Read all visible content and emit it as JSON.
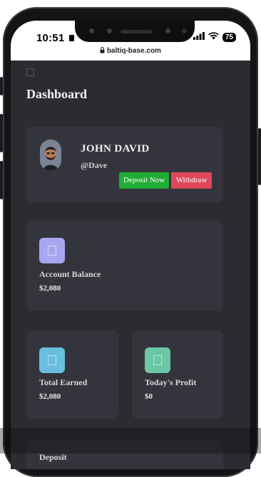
{
  "status_bar": {
    "time": "10:51",
    "signal_icon": "signal-bars-icon",
    "wifi_icon": "wifi-icon",
    "battery_level": "75"
  },
  "browser": {
    "url": "baltiq-base.com",
    "lock_icon": "lock-icon"
  },
  "header": {
    "title": "Dashboard",
    "menu_icon": "menu-icon"
  },
  "profile": {
    "name": "JOHN DAVID",
    "handle": "@Dave",
    "deposit_label": "Deposit Now",
    "withdraw_label": "Withdraw"
  },
  "stats": {
    "account_balance": {
      "label": "Account Balance",
      "value": "$2,080",
      "icon": "wallet-icon",
      "color": "#a9a6f0"
    },
    "total_earned": {
      "label": "Total Earned",
      "value": "$2,080",
      "icon": "earnings-icon",
      "color": "#68bedf"
    },
    "todays_profit": {
      "label": "Today's Profit",
      "value": "$0",
      "icon": "profit-icon",
      "color": "#6bc7a6"
    }
  },
  "deposit_section": {
    "title": "Deposit"
  },
  "colors": {
    "background": "#2b2c32",
    "card": "#34353c",
    "deposit_button": "#21ad35",
    "withdraw_button": "#e0485a"
  }
}
